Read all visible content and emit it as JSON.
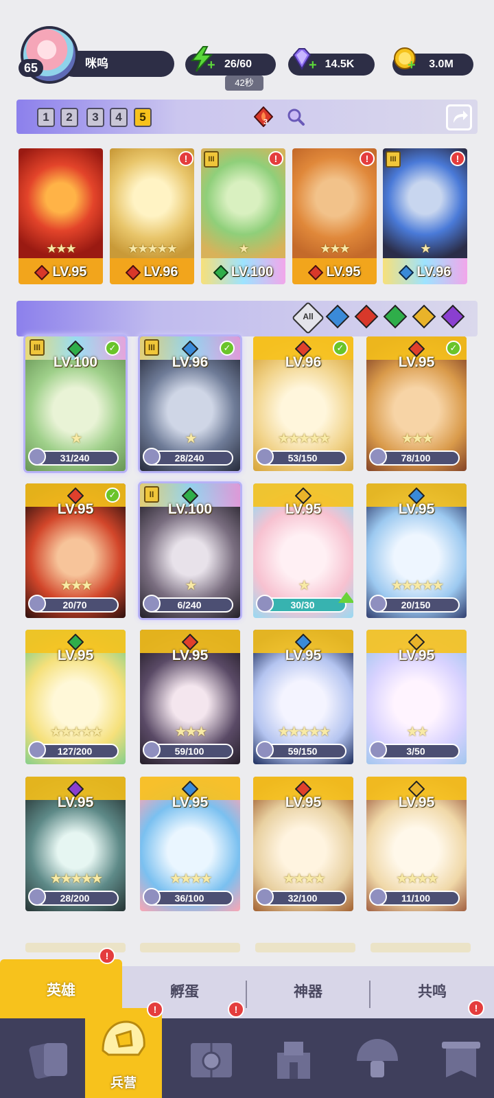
{
  "player": {
    "level": "65",
    "name": "咪呜"
  },
  "resources": {
    "energy": "26/60",
    "energy_timer": "42秒",
    "gems": "14.5K",
    "gold": "3.0M"
  },
  "team_bar": {
    "tabs": [
      "1",
      "2",
      "3",
      "4",
      "5"
    ],
    "active_tab": "5",
    "fire_count": "3"
  },
  "team": [
    {
      "level": "LV.95",
      "element": "fire",
      "stars": "★★★",
      "tier": ""
    },
    {
      "level": "LV.96",
      "element": "fire",
      "stars": "★★★★★",
      "tier": ""
    },
    {
      "level": "LV.100",
      "element": "nature",
      "stars": "★",
      "tier": "III"
    },
    {
      "level": "LV.95",
      "element": "fire",
      "stars": "★★★",
      "tier": ""
    },
    {
      "level": "LV.96",
      "element": "water",
      "stars": "★",
      "tier": "III"
    }
  ],
  "filters": {
    "all_label": "All",
    "elements": [
      "water",
      "fire",
      "nature",
      "light",
      "dark"
    ]
  },
  "heroes": [
    {
      "level": "LV.100",
      "element": "nature",
      "shards": "31/240",
      "stars": "★",
      "tier": "III",
      "check": true
    },
    {
      "level": "LV.96",
      "element": "water",
      "shards": "28/240",
      "stars": "★",
      "tier": "III",
      "check": true
    },
    {
      "level": "LV.96",
      "element": "fire",
      "shards": "53/150",
      "stars": "★★★★★",
      "tier": "",
      "check": true
    },
    {
      "level": "LV.95",
      "element": "fire",
      "shards": "78/100",
      "stars": "★★★",
      "tier": "",
      "check": true
    },
    {
      "level": "LV.95",
      "element": "fire",
      "shards": "20/70",
      "stars": "★★★",
      "tier": "",
      "check": true
    },
    {
      "level": "LV.100",
      "element": "nature",
      "shards": "6/240",
      "stars": "★",
      "tier": "II",
      "check": false
    },
    {
      "level": "LV.95",
      "element": "light",
      "shards": "30/30",
      "stars": "★",
      "tier": "",
      "check": false
    },
    {
      "level": "LV.95",
      "element": "water",
      "shards": "20/150",
      "stars": "★★★★★",
      "tier": "",
      "check": false
    },
    {
      "level": "LV.95",
      "element": "nature",
      "shards": "127/200",
      "stars": "★★★★★",
      "tier": "",
      "check": false
    },
    {
      "level": "LV.95",
      "element": "fire",
      "shards": "59/100",
      "stars": "★★★",
      "tier": "",
      "check": false
    },
    {
      "level": "LV.95",
      "element": "water",
      "shards": "59/150",
      "stars": "★★★★★",
      "tier": "",
      "check": false
    },
    {
      "level": "LV.95",
      "element": "light",
      "shards": "3/50",
      "stars": "★★",
      "tier": "",
      "check": false
    },
    {
      "level": "LV.95",
      "element": "dark",
      "shards": "28/200",
      "stars": "★★★★★",
      "tier": "",
      "check": false
    },
    {
      "level": "LV.95",
      "element": "water",
      "shards": "36/100",
      "stars": "★★★★",
      "tier": "",
      "check": false
    },
    {
      "level": "LV.95",
      "element": "fire",
      "shards": "32/100",
      "stars": "★★★★",
      "tier": "",
      "check": false
    },
    {
      "level": "LV.95",
      "element": "light",
      "shards": "11/100",
      "stars": "★★★★",
      "tier": "",
      "check": false
    }
  ],
  "subtabs": [
    "英雄",
    "孵蛋",
    "神器",
    "共鸣"
  ],
  "nav": {
    "active_label": "兵营"
  },
  "colors": {
    "fire": "#e0402c",
    "water": "#3a8ad8",
    "nature": "#2fae4a",
    "light": "#e9b32a",
    "dark": "#8a3fd0",
    "accent": "#f7c21c"
  }
}
